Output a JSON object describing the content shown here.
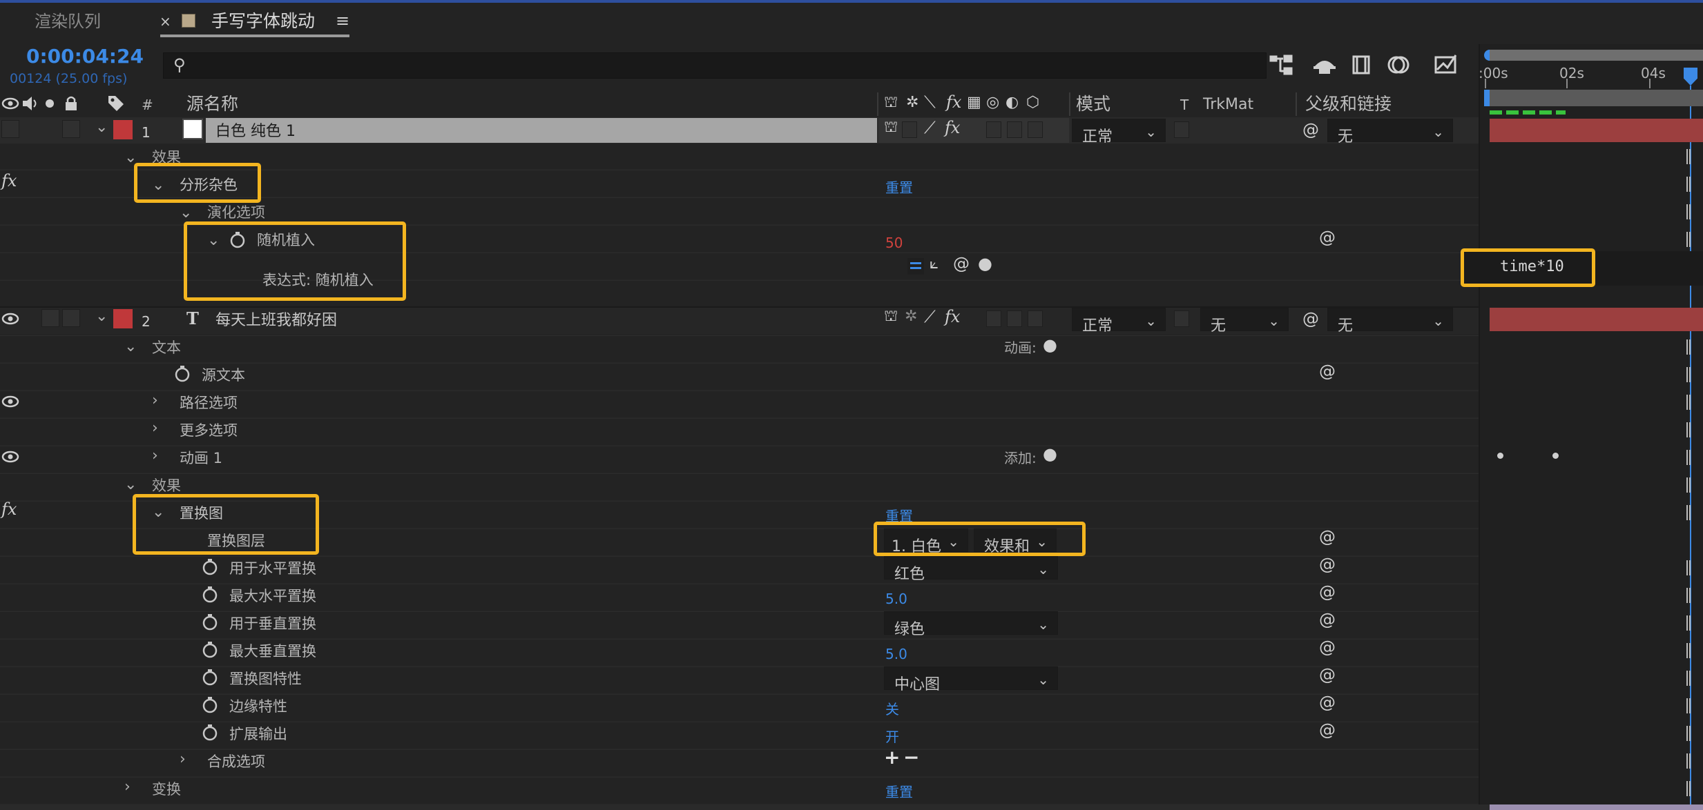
{
  "tabs": [
    {
      "label": "渲染队列"
    },
    {
      "label": "手写字体跳动"
    }
  ],
  "timecode": "0:00:04:24",
  "frame_info": "00124 (25.00 fps)",
  "search": {
    "placeholder": ""
  },
  "ruler": {
    "labels": [
      ":00s",
      "02s",
      "04s"
    ]
  },
  "headers": {
    "source_name": "源名称",
    "number": "#",
    "mode": "模式",
    "t": "T",
    "trkmat": "TrkMat",
    "parent": "父级和链接"
  },
  "layers": [
    {
      "index": "1",
      "name": "白色 纯色 1",
      "mode": "正常",
      "parent": "无",
      "color": "#c0383a"
    },
    {
      "index": "2",
      "name": "每天上班我都好困",
      "mode": "正常",
      "trkmat": "无",
      "parent": "无",
      "color": "#c0383a"
    }
  ],
  "rows": {
    "effects1": "效果",
    "fractal_noise": "分形杂色",
    "reset1": "重置",
    "evolution": "演化选项",
    "random_seed": "随机植入",
    "random_seed_value": "50",
    "expression_label": "表达式: 随机植入",
    "expression_text": "time*10",
    "text_group": "文本",
    "animate_label": "动画:",
    "source_text": "源文本",
    "path_options": "路径选项",
    "more_options": "更多选项",
    "animator1": "动画 1",
    "add_label": "添加:",
    "effects2": "效果",
    "displacement_map": "置换图",
    "reset2": "重置",
    "disp_layer": "置换图层",
    "disp_layer_value1": "1. 白色",
    "disp_layer_value2": "效果和",
    "use_h": "用于水平置换",
    "use_h_value": "红色",
    "max_h": "最大水平置换",
    "max_h_value": "5.0",
    "use_v": "用于垂直置换",
    "use_v_value": "绿色",
    "max_v": "最大垂直置换",
    "max_v_value": "5.0",
    "map_behavior": "置换图特性",
    "map_behavior_value": "中心图",
    "edge_behavior": "边缘特性",
    "edge_behavior_value": "关",
    "expand_output": "扩展输出",
    "expand_output_value": "开",
    "comp_options": "合成选项",
    "transform": "变换",
    "reset3": "重置"
  },
  "colors": {
    "accent": "#3c8ae6",
    "highlight": "#f3b520",
    "label_red": "#c0383a",
    "value_red": "#d0423d"
  }
}
